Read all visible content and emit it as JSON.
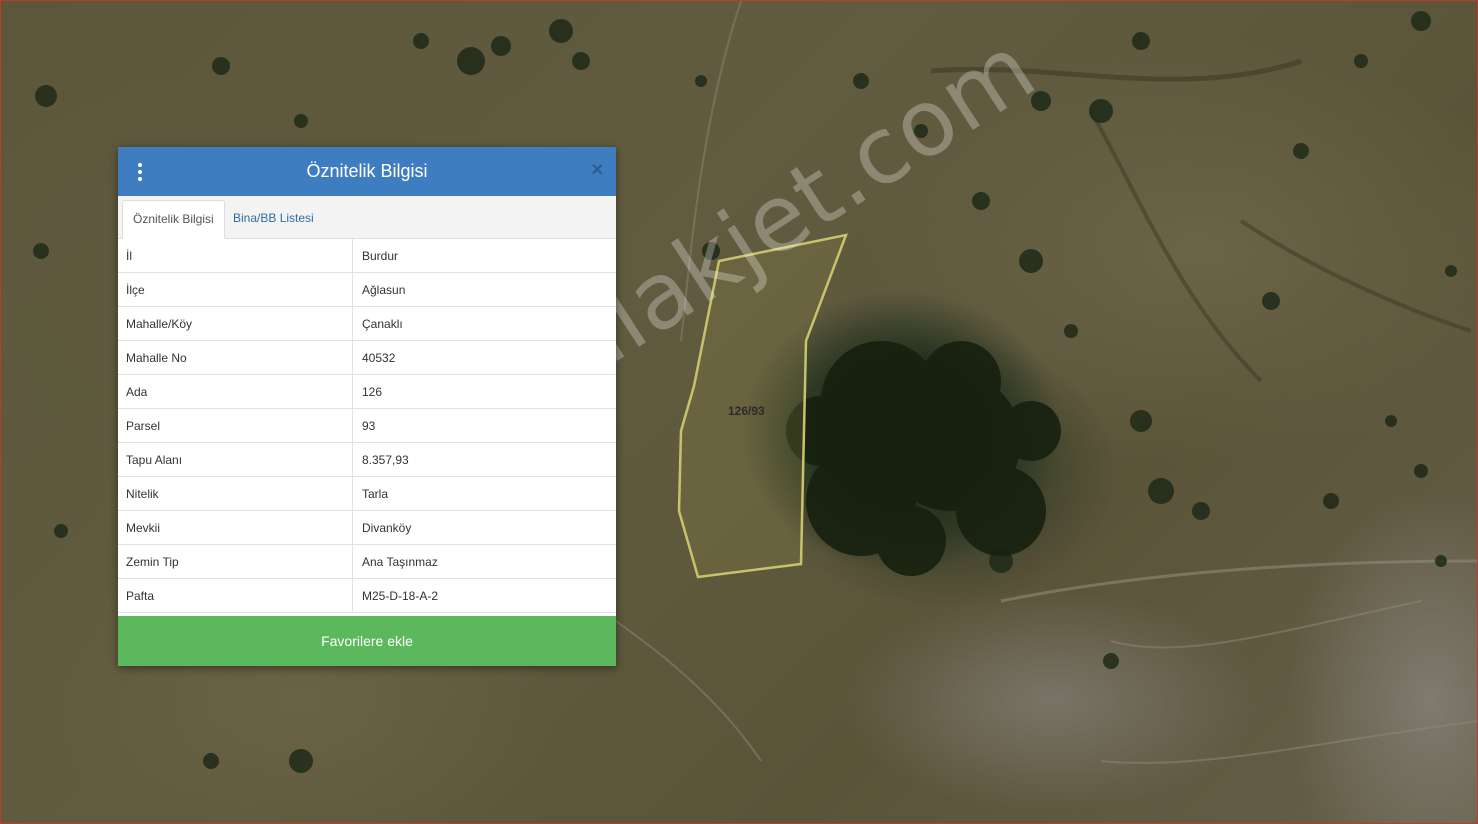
{
  "map": {
    "parcel_label": "126/93",
    "watermark": "emlakjet.com"
  },
  "panel": {
    "title": "Öznitelik Bilgisi",
    "close_glyph": "×",
    "tabs": [
      {
        "label": "Öznitelik Bilgisi",
        "active": true
      },
      {
        "label": "Bina/BB Listesi",
        "active": false
      }
    ],
    "rows": [
      {
        "key": "İl",
        "value": "Burdur"
      },
      {
        "key": "İlçe",
        "value": "Ağlasun"
      },
      {
        "key": "Mahalle/Köy",
        "value": "Çanaklı"
      },
      {
        "key": "Mahalle No",
        "value": "40532"
      },
      {
        "key": "Ada",
        "value": "126"
      },
      {
        "key": "Parsel",
        "value": "93"
      },
      {
        "key": "Tapu Alanı",
        "value": "8.357,93"
      },
      {
        "key": "Nitelik",
        "value": "Tarla"
      },
      {
        "key": "Mevkii",
        "value": "Divanköy"
      },
      {
        "key": "Zemin Tip",
        "value": "Ana Taşınmaz"
      },
      {
        "key": "Pafta",
        "value": "M25-D-18-A-2"
      }
    ],
    "favorite_button": "Favorilere ekle"
  },
  "colors": {
    "header": "#3e7dbf",
    "button": "#5cb85c",
    "tab_link": "#2e6da4",
    "parcel_outline": "#c8c36a"
  },
  "icons": {
    "menu": "vertical-dots-icon",
    "close": "close-icon"
  }
}
